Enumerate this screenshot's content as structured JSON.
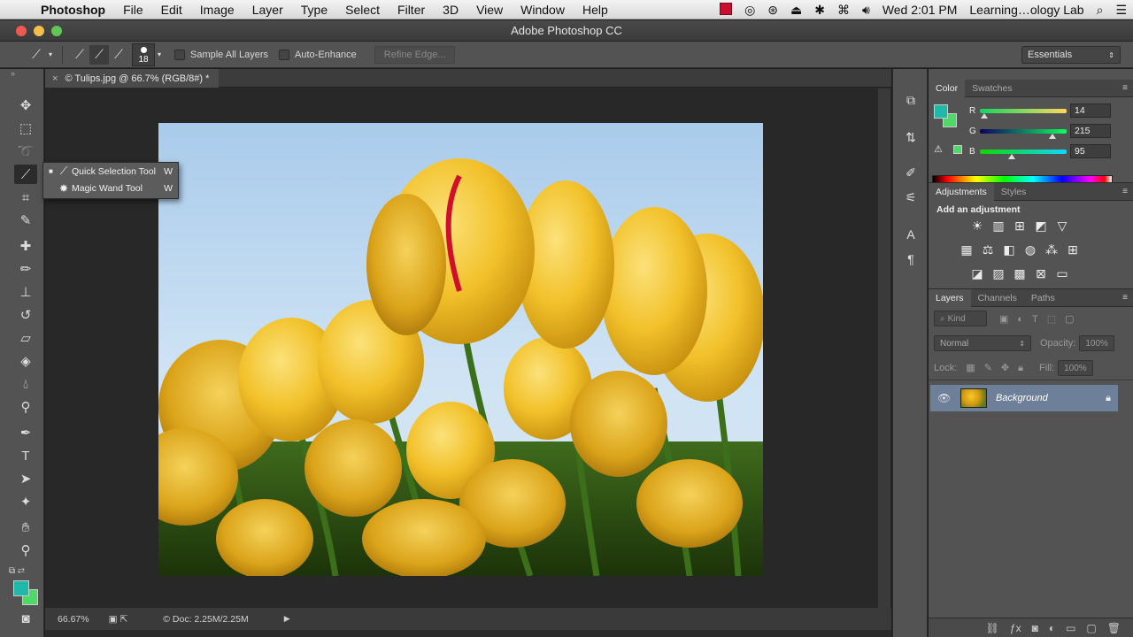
{
  "menubar": {
    "items": [
      "Photoshop",
      "File",
      "Edit",
      "Image",
      "Layer",
      "Type",
      "Select",
      "Filter",
      "3D",
      "View",
      "Window",
      "Help"
    ],
    "clock": "Wed 2:01 PM",
    "user": "Learning…ology Lab"
  },
  "window": {
    "title": "Adobe Photoshop CC"
  },
  "options": {
    "brush_size": "18",
    "sample_all_layers": "Sample All Layers",
    "auto_enhance": "Auto-Enhance",
    "refine_edge": "Refine Edge...",
    "workspace": "Essentials"
  },
  "flyout": {
    "items": [
      {
        "label": "Quick Selection Tool",
        "shortcut": "W"
      },
      {
        "label": "Magic Wand Tool",
        "shortcut": "W"
      }
    ]
  },
  "document": {
    "tab": "© Tulips.jpg @ 66.7% (RGB/8#) *",
    "zoom": "66.67%",
    "doc_size": "© Doc: 2.25M/2.25M"
  },
  "color_panel": {
    "tabs": [
      "Color",
      "Swatches"
    ],
    "r": "14",
    "g": "215",
    "b": "95",
    "r_frac": 0.05,
    "g_frac": 0.84,
    "b_frac": 0.37,
    "fg": "#20b8a8",
    "bg": "#4fd968"
  },
  "adjustments_panel": {
    "tabs": [
      "Adjustments",
      "Styles"
    ],
    "heading": "Add an adjustment"
  },
  "layers_panel": {
    "tabs": [
      "Layers",
      "Channels",
      "Paths"
    ],
    "kind": "Kind",
    "blend_mode": "Normal",
    "opacity_label": "Opacity:",
    "opacity": "100%",
    "lock_label": "Lock:",
    "fill_label": "Fill:",
    "fill": "100%",
    "layer_name": "Background"
  }
}
